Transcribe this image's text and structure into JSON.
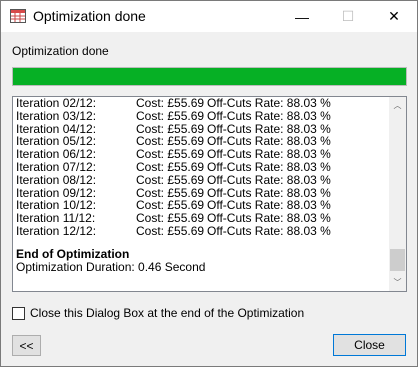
{
  "window": {
    "title": "Optimization done"
  },
  "titlebar": {
    "minimize_glyph": "—",
    "maximize_glyph": "☐",
    "close_glyph": "✕"
  },
  "status": {
    "label": "Optimization done",
    "progress_percent": 100,
    "progress_color": "#06b025"
  },
  "log": {
    "iterations": [
      {
        "iteration": "Iteration 02/12:",
        "cost": "Cost: £55.69",
        "rate": "Off-Cuts Rate: 88.03 %"
      },
      {
        "iteration": "Iteration 03/12:",
        "cost": "Cost: £55.69",
        "rate": "Off-Cuts Rate: 88.03 %"
      },
      {
        "iteration": "Iteration 04/12:",
        "cost": "Cost: £55.69",
        "rate": "Off-Cuts Rate: 88.03 %"
      },
      {
        "iteration": "Iteration 05/12:",
        "cost": "Cost: £55.69",
        "rate": "Off-Cuts Rate: 88.03 %"
      },
      {
        "iteration": "Iteration 06/12:",
        "cost": "Cost: £55.69",
        "rate": "Off-Cuts Rate: 88.03 %"
      },
      {
        "iteration": "Iteration 07/12:",
        "cost": "Cost: £55.69",
        "rate": "Off-Cuts Rate: 88.03 %"
      },
      {
        "iteration": "Iteration 08/12:",
        "cost": "Cost: £55.69",
        "rate": "Off-Cuts Rate: 88.03 %"
      },
      {
        "iteration": "Iteration 09/12:",
        "cost": "Cost: £55.69",
        "rate": "Off-Cuts Rate: 88.03 %"
      },
      {
        "iteration": "Iteration 10/12:",
        "cost": "Cost: £55.69",
        "rate": "Off-Cuts Rate: 88.03 %"
      },
      {
        "iteration": "Iteration 11/12:",
        "cost": "Cost: £55.69",
        "rate": "Off-Cuts Rate: 88.03 %"
      },
      {
        "iteration": "Iteration 12/12:",
        "cost": "Cost: £55.69",
        "rate": "Off-Cuts Rate: 88.03 %"
      }
    ],
    "end_title": "End of Optimization",
    "duration": "Optimization Duration: 0.46 Second"
  },
  "options": {
    "close_at_end_label": "Close this Dialog Box at the end of the Optimization",
    "close_at_end_checked": false
  },
  "buttons": {
    "back_label": "<<",
    "close_label": "Close"
  }
}
